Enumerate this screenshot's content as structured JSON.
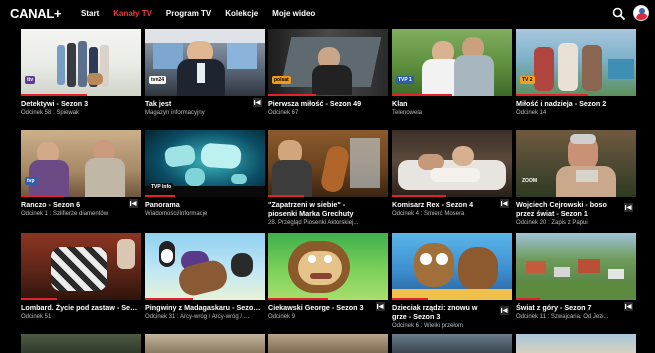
{
  "header": {
    "logo": "CANAL+",
    "nav": [
      {
        "label": "Start",
        "active": false
      },
      {
        "label": "Kanały TV",
        "active": true
      },
      {
        "label": "Program TV",
        "active": false
      },
      {
        "label": "Kolekcje",
        "active": false
      },
      {
        "label": "Moje wideo",
        "active": false
      }
    ],
    "search_icon": "search-icon",
    "avatar_icon": "profile-avatar"
  },
  "colors": {
    "accent": "#e3232b",
    "nav_active": "#e53a3a",
    "subtitle": "#bdbdbd",
    "background": "#000000"
  },
  "rows": [
    [
      {
        "title": "Detektywi - Sezon 3",
        "subtitle": "Odcinek 58 : Śpiewak",
        "channel": "ttv",
        "progress": 0.55,
        "restart": false
      },
      {
        "title": "Tak jest",
        "subtitle": "Magazyn informacyjny",
        "channel": "tvn24",
        "progress": 0,
        "restart": true
      },
      {
        "title": "Pierwsza miłość - Sezon 49",
        "subtitle": "Odcinek 67",
        "channel": "polsat",
        "progress": 0.4,
        "restart": false
      },
      {
        "title": "Klan",
        "subtitle": "Telenowela",
        "channel": "TVP 1",
        "progress": 0.5,
        "restart": false
      },
      {
        "title": "Miłość i nadzieja - Sezon 2",
        "subtitle": "Odcinek 14",
        "channel": "TV 2",
        "progress": 0.6,
        "restart": false
      }
    ],
    [
      {
        "title": "Ranczo - Sezon 6",
        "subtitle": "Odcinek 1 : Szlifierze diamentów",
        "channel": "tvp",
        "progress": 0.35,
        "restart": true
      },
      {
        "title": "Panorama",
        "subtitle": "Wiadomości/Informacje",
        "channel": "TVP Info",
        "progress": 0.25,
        "restart": false
      },
      {
        "title": "\"Zapatrzeni w siebie\" - piosenki Marka Grechuty",
        "subtitle": "28. Przegląd Piosenki Aktorskiej...",
        "channel": "",
        "progress": 0.3,
        "restart": false
      },
      {
        "title": "Komisarz Rex - Sezon 4",
        "subtitle": "Odcinek 4 : Śmierć Mosera",
        "channel": "",
        "progress": 0.45,
        "restart": true
      },
      {
        "title": "Wojciech Cejrowski - boso przez świat - Sezon 1",
        "subtitle": "Odcinek 20 : Zapis z Papui",
        "channel": "ZOOM",
        "progress": 0,
        "restart": true
      }
    ],
    [
      {
        "title": "Lombard. Życie pod zastaw - Sezon 16",
        "subtitle": "Odcinek 51",
        "channel": "",
        "progress": 0.3,
        "restart": false
      },
      {
        "title": "Pingwiny z Madagaskaru - Sezon 2",
        "subtitle": "Odcinek 31 : Arcy-wróg / Arcy-wróg / Wiele...",
        "channel": "",
        "progress": 0.4,
        "restart": false
      },
      {
        "title": "Ciekawski George - Sezon 3",
        "subtitle": "Odcinek 9",
        "channel": "",
        "progress": 0.5,
        "restart": true
      },
      {
        "title": "Dzieciak rządzi: znowu w grze - Sezon 3",
        "subtitle": "Odcinek 6 : Wielki przełom",
        "channel": "",
        "progress": 0.3,
        "restart": true
      },
      {
        "title": "Świat z góry - Sezon 7",
        "subtitle": "Odcinek 11 : Szwajcaria. Od Jezi...",
        "channel": "",
        "progress": 0.2,
        "restart": true
      }
    ]
  ]
}
